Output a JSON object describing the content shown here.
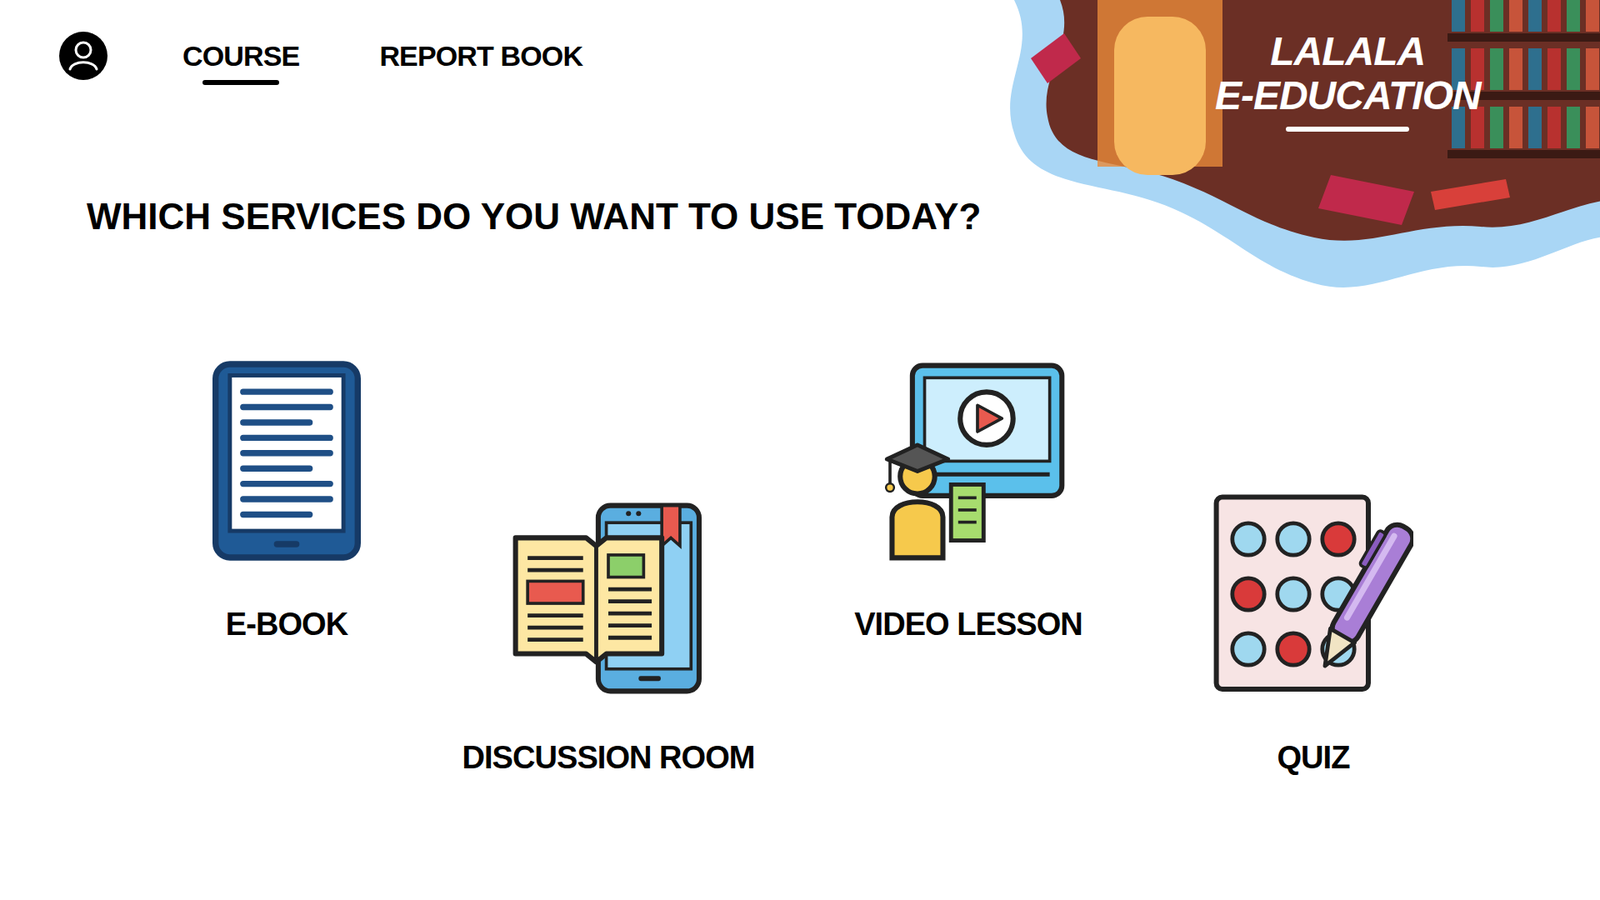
{
  "nav": [
    {
      "label": "COURSE",
      "selected": true
    },
    {
      "label": "REPORT BOOK",
      "selected": false
    }
  ],
  "brand": {
    "lines": [
      "LALALA",
      "E-EDUCATION"
    ]
  },
  "heading": "WHICH SERVICES DO YOU WANT TO USE TODAY?",
  "services": [
    {
      "label": "E-BOOK",
      "kind": "ebook"
    },
    {
      "label": "DISCUSSION ROOM",
      "kind": "discussion"
    },
    {
      "label": "VIDEO LESSON",
      "kind": "video"
    },
    {
      "label": "QUIZ",
      "kind": "quiz"
    }
  ]
}
